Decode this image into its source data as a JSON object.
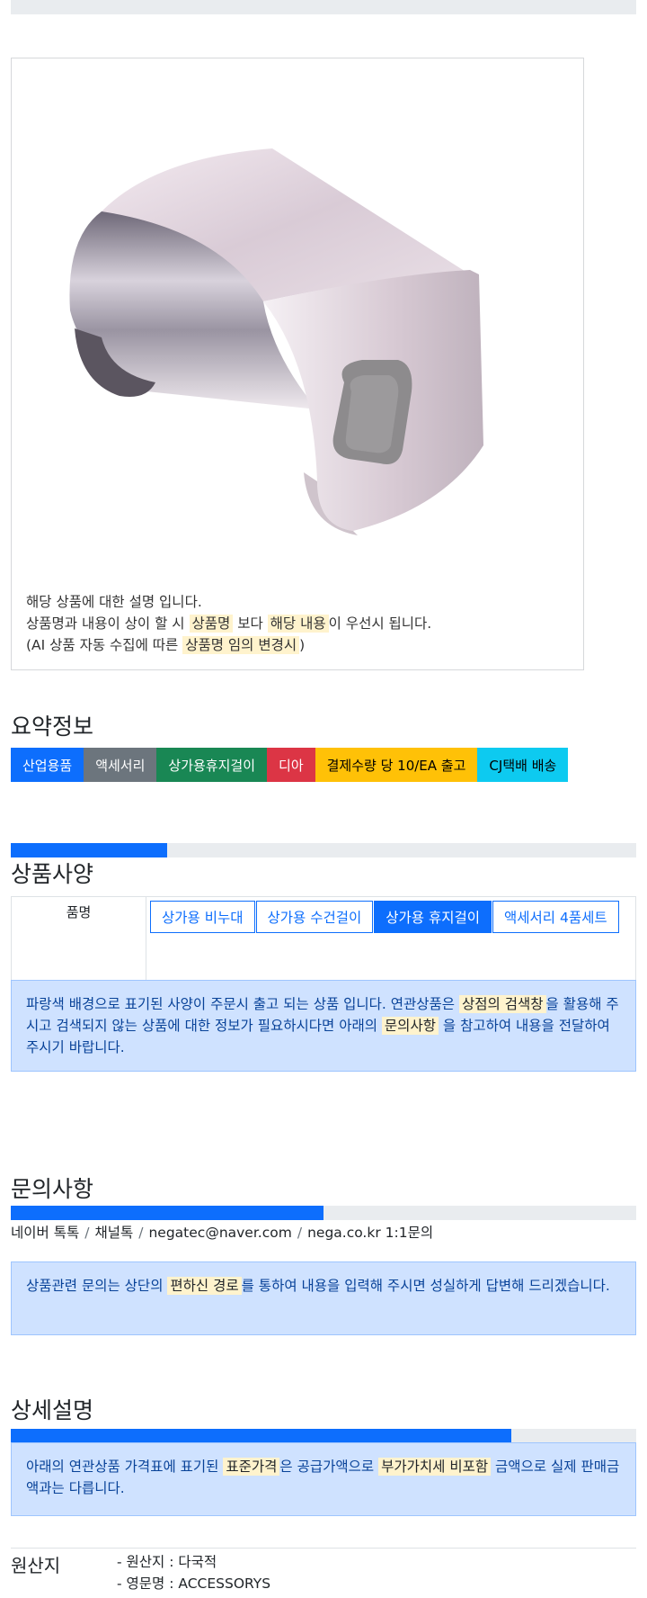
{
  "image_description": {
    "line1": "해당 상품에 대한 설명 입니다.",
    "line2_a": "상품명과 내용이 상이 할 시 ",
    "line2_mark1": "상품명",
    "line2_b": " 보다 ",
    "line2_mark2": "해당 내용",
    "line2_c": "이 우선시 됩니다.",
    "line3_a": "(AI 상품 자동 수집에 따른 ",
    "line3_mark": "상품명 임의 변경시",
    "line3_b": ")"
  },
  "summary": {
    "title": "요약정보",
    "badges": [
      {
        "label": "산업용품",
        "color": "#0d6efd",
        "text_color": "#ffffff"
      },
      {
        "label": "액세서리",
        "color": "#6c757d",
        "text_color": "#ffffff"
      },
      {
        "label": "상가용휴지걸이",
        "color": "#198754",
        "text_color": "#ffffff"
      },
      {
        "label": "디아",
        "color": "#dc3545",
        "text_color": "#ffffff"
      },
      {
        "label": "결제수량 당 10/EA 출고",
        "color": "#ffc107",
        "text_color": "#000000"
      },
      {
        "label": "CJ택배 배송",
        "color": "#0dcaf0",
        "text_color": "#000000"
      }
    ]
  },
  "spec": {
    "progress": 0.25,
    "title": "상품사양",
    "label": "품명",
    "options": [
      {
        "label": "상가용 비누대",
        "selected": false
      },
      {
        "label": "상가용 수건걸이",
        "selected": false
      },
      {
        "label": "상가용 휴지걸이",
        "selected": true
      },
      {
        "label": "액세서리 4품세트",
        "selected": false
      }
    ],
    "notice_a": "파랑색 배경으로 표기된 사양이 주문시 출고 되는 상품 입니다. 연관상품은 ",
    "notice_mark1": "상점의 검색창",
    "notice_b": "을 활용해 주시고 검색되지 않는 상품에 대한 정보가 필요하시다면 아래의 ",
    "notice_mark2": "문의사항",
    "notice_c": " 을 참고하여 내용을 전달하여 주시기 바랍니다."
  },
  "inquiry": {
    "title": "문의사항",
    "progress": 0.5,
    "contacts": [
      "네이버 톡톡",
      "채널톡",
      "negatec@naver.com",
      "nega.co.kr 1:1문의"
    ],
    "separator": "/",
    "notice_a": "상품관련 문의는 상단의 ",
    "notice_mark": "편하신 경로",
    "notice_b": "를 통하여 내용을 입력해 주시면 성실하게 답변해 드리겠습니다."
  },
  "detail": {
    "title": "상세설명",
    "progress": 0.8,
    "notice_a": "아래의 연관상품 가격표에 표기된 ",
    "notice_mark1": "표준가격",
    "notice_b": "은 공급가액으로 ",
    "notice_mark2": "부가가치세 비포함",
    "notice_c": " 금액으로 실제 판매금액과는 다릅니다."
  },
  "origin": {
    "label": "원산지",
    "items": [
      "- 원산지 : 다국적",
      "- 영문명 : ACCESSORYS"
    ]
  }
}
